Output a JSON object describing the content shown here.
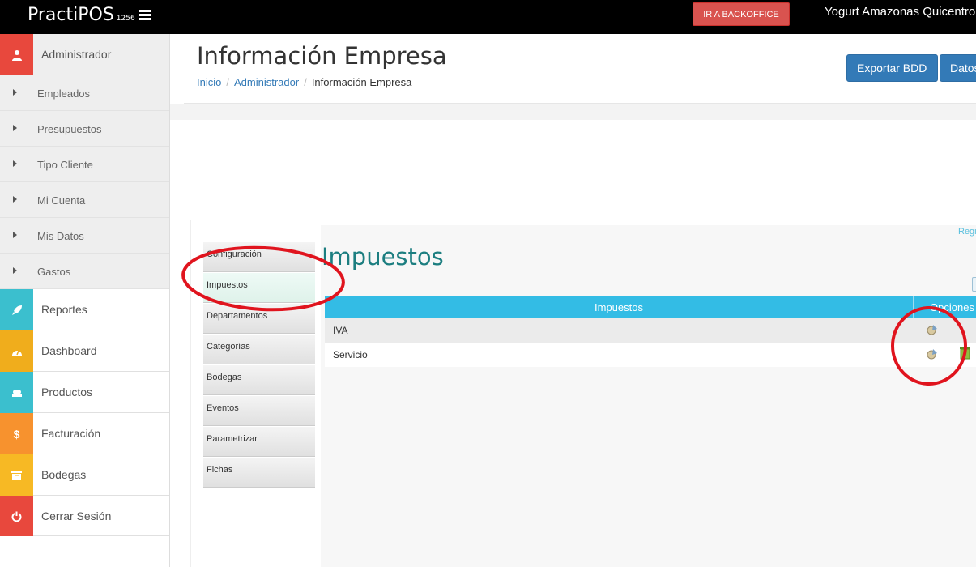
{
  "topbar": {
    "brand": "PractiPOS",
    "brand_sub": "1256",
    "backoffice_button": "IR A BACKOFFICE",
    "store_name": "Yogurt Amazonas Quicentro"
  },
  "sidebar": {
    "admin": "Administrador",
    "sub_items": [
      "Empleados",
      "Presupuestos",
      "Tipo Cliente",
      "Mi Cuenta",
      "Mis Datos",
      "Gastos"
    ],
    "items": [
      {
        "label": "Reportes",
        "color": "#3bbfce",
        "icon": "rocket-icon"
      },
      {
        "label": "Dashboard",
        "color": "#f0ad1c",
        "icon": "dashboard-icon"
      },
      {
        "label": "Productos",
        "color": "#3bbfce",
        "icon": "products-icon"
      },
      {
        "label": "Facturación",
        "color": "#f7922e",
        "icon": "dollar-icon"
      },
      {
        "label": "Bodegas",
        "color": "#f7b924",
        "icon": "archive-icon"
      },
      {
        "label": "Cerrar Sesión",
        "color": "#e8483d",
        "icon": "power-icon"
      }
    ],
    "admin_color": "#e8483d"
  },
  "header": {
    "title": "Información Empresa",
    "breadcrumb": [
      "Inicio",
      "Administrador",
      "Información Empresa"
    ],
    "export_button": "Exportar BDD",
    "data_button": "Datos"
  },
  "tabs": [
    "Configuración",
    "Impuestos",
    "Departamentos",
    "Categorías",
    "Bodegas",
    "Eventos",
    "Parametrizar",
    "Fichas"
  ],
  "panel": {
    "register_link": "Registrar",
    "section_title": "Impuestos",
    "table_headers": [
      "Impuestos",
      "Opciones"
    ],
    "rows": [
      "IVA",
      "Servicio"
    ]
  },
  "colors": {
    "accent": "#33bce5",
    "primary": "#337ab7",
    "danger": "#d9534f",
    "annotation": "#e0141e"
  }
}
